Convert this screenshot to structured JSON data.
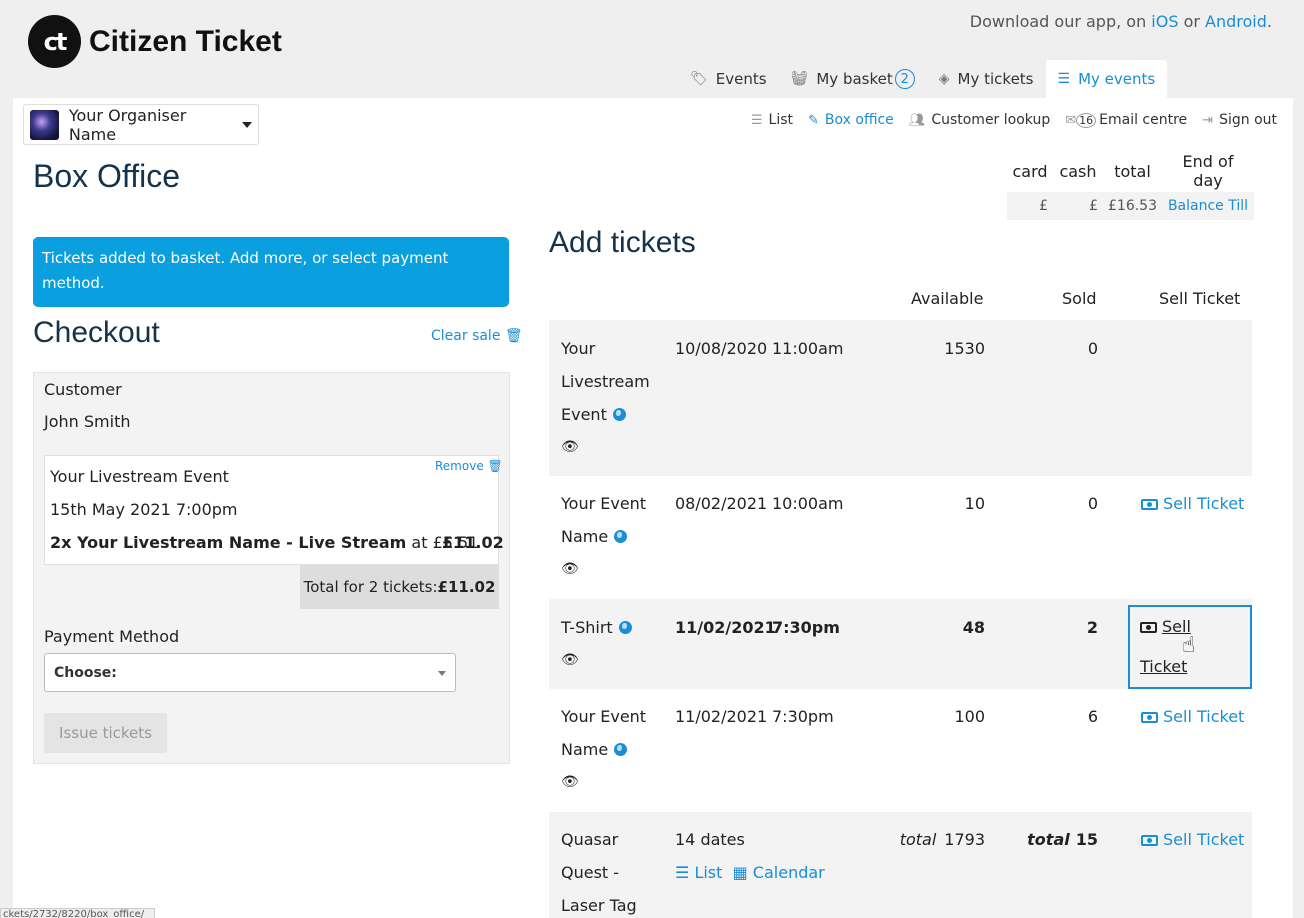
{
  "brand": {
    "logo_mark": "ct",
    "name": "Citizen Ticket"
  },
  "download": {
    "prefix": "Download our app, on ",
    "ios": "iOS",
    "or": " or ",
    "android": "Android",
    "suffix": "."
  },
  "nav": {
    "events": "Events",
    "basket": "My basket",
    "basket_count": "2",
    "tickets": "My tickets",
    "my_events": "My events"
  },
  "organiser": {
    "name": "Your Organiser Name"
  },
  "subnav": {
    "list": "List",
    "box_office": "Box office",
    "customer_lookup": "Customer lookup",
    "email_count": "16",
    "email_centre": "Email centre",
    "sign_out": "Sign out"
  },
  "page": {
    "title": "Box Office"
  },
  "till": {
    "headers": [
      "card",
      "cash",
      "total",
      "End of day"
    ],
    "card": "£",
    "cash": "£",
    "total": "£16.53",
    "action": "Balance Till"
  },
  "alert": {
    "message": "Tickets added to basket. Add more, or select payment method."
  },
  "checkout": {
    "title": "Checkout",
    "clear": "Clear sale",
    "customer_label": "Customer",
    "customer_name": "John Smith",
    "item": {
      "remove": "Remove",
      "event": "Your Livestream Event",
      "date": "15th May 2021 7:00pm",
      "qty_name": "2x Your Livestream Name - Live Stream",
      "at": " at £5.51",
      "price": "£11.02"
    },
    "total_prefix": "Total for 2 tickets: ",
    "total_value": "£11.02",
    "payment_label": "Payment Method",
    "payment_selected": "Choose:",
    "issue": "Issue tickets"
  },
  "add_tickets": {
    "title": "Add tickets",
    "headers": {
      "available": "Available",
      "sold": "Sold",
      "sell": "Sell Ticket"
    },
    "rows": [
      {
        "name1": "Your",
        "name2": "Livestream",
        "name3": "Event",
        "date": "10/08/2020",
        "time": "11:00am",
        "available": "1530",
        "sold": "0",
        "sell": ""
      },
      {
        "name1": "Your Event",
        "name2": "Name",
        "date": "08/02/2021",
        "time": "10:00am",
        "available": "10",
        "sold": "0",
        "sell": "Sell Ticket"
      },
      {
        "name1": "T-Shirt",
        "date": "11/02/2021",
        "time": "7:30pm",
        "available": "48",
        "sold": "2",
        "sell": "Sell Ticket"
      },
      {
        "name1": "Your Event",
        "name2": "Name",
        "date": "11/02/2021",
        "time": "7:30pm",
        "available": "100",
        "sold": "6",
        "sell": "Sell Ticket"
      },
      {
        "name1": "Quasar",
        "name2": "Quest -",
        "name3": "Laser Tag",
        "dates": "14 dates",
        "list": "List",
        "calendar": "Calendar",
        "avail_prefix": "total",
        "available": "1793",
        "sold_prefix": "total",
        "sold": "15",
        "sell": "Sell Ticket"
      }
    ]
  },
  "statusbar": {
    "url": "ckets/2732/8220/box_office/"
  }
}
